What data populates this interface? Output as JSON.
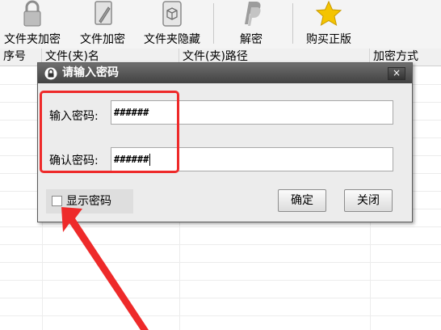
{
  "toolbar": {
    "items": [
      {
        "label": "文件夹加密",
        "icon": "padlock-icon"
      },
      {
        "label": "文件加密",
        "icon": "document-pen-icon"
      },
      {
        "label": "文件夹隐藏",
        "icon": "cube-icon"
      },
      {
        "label": "解密",
        "icon": "paypal-icon"
      },
      {
        "label": "购买正版",
        "icon": "star-icon"
      }
    ]
  },
  "table": {
    "columns": [
      "序号",
      "文件(夹)名",
      "文件(夹)路径",
      "加密方式"
    ]
  },
  "dialog": {
    "title": "请输入密码",
    "close_label": "×",
    "password_label": "输入密码:",
    "password_value": "######",
    "confirm_label": "确认密码:",
    "confirm_value": "######",
    "show_password_label": "显示密码",
    "show_password_checked": false,
    "ok_label": "确定",
    "close_button_label": "关闭"
  },
  "colors": {
    "highlight": "#ee2a2a",
    "titlebar": "#4a4a4a",
    "star": "#f4c400"
  }
}
